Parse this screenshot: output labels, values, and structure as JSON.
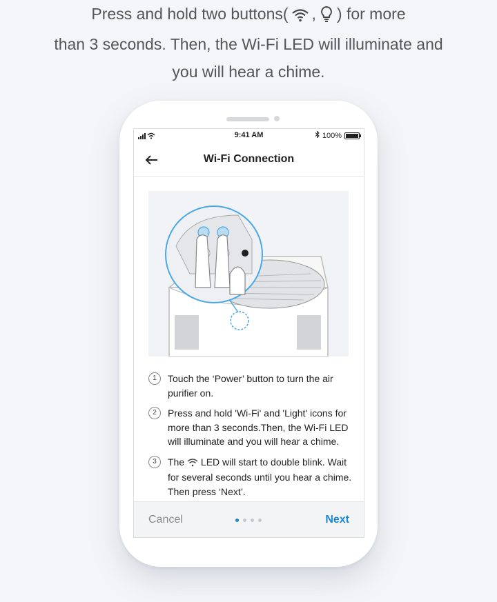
{
  "instruction": {
    "line1_pre": "Press and hold two buttons(",
    "line1_sep": ",",
    "line1_post": ") for more",
    "line2": "than 3 seconds. Then, the Wi-Fi LED will illuminate and",
    "line3": "you will hear a chime."
  },
  "status_bar": {
    "time": "9:41 AM",
    "battery": "100%"
  },
  "header": {
    "title": "Wi-Fi Connection",
    "back_icon": "arrow-left-icon"
  },
  "steps": [
    {
      "num": "1",
      "text": "Touch the ‘Power’ button to turn the air purifier on."
    },
    {
      "num": "2",
      "text": "Press and hold 'Wi-Fi' and 'Light' icons for more than 3 seconds.Then, the Wi-Fi LED will illuminate and you will hear a chime."
    },
    {
      "num": "3",
      "pre": "The",
      "post": "LED will start to double blink. Wait for several seconds until you hear a chime. Then press ‘Next’."
    }
  ],
  "footer": {
    "cancel": "Cancel",
    "next": "Next",
    "page_count": 4,
    "active_page": 1
  },
  "colors": {
    "accent": "#1a87d4",
    "highlight": "#4aa8e6"
  }
}
